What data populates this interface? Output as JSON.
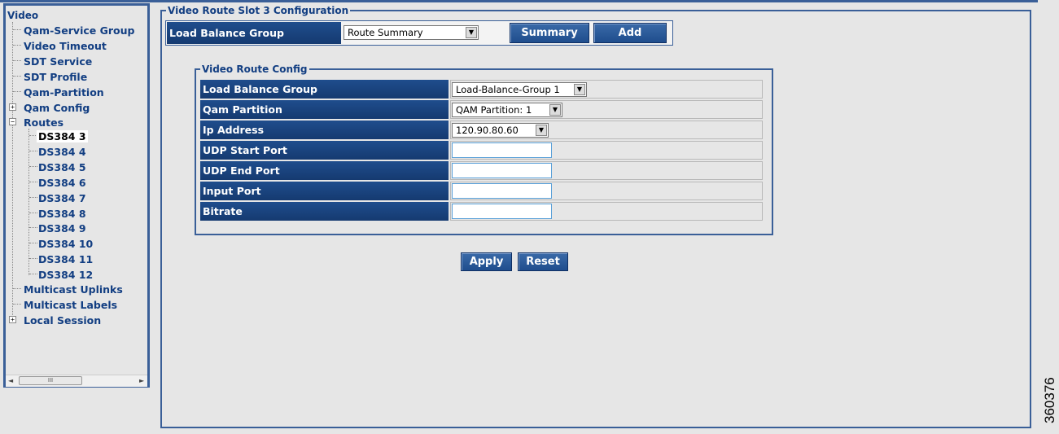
{
  "tree": {
    "root": "Video",
    "items": [
      {
        "label": "Qam-Service Group"
      },
      {
        "label": "Video Timeout"
      },
      {
        "label": "SDT Service"
      },
      {
        "label": "SDT Profile"
      },
      {
        "label": "Qam-Partition"
      },
      {
        "label": "Qam Config",
        "expander": "+"
      },
      {
        "label": "Routes",
        "expander": "−"
      },
      {
        "label": "DS384 3",
        "selected": true
      },
      {
        "label": "DS384 4"
      },
      {
        "label": "DS384 5"
      },
      {
        "label": "DS384 6"
      },
      {
        "label": "DS384 7"
      },
      {
        "label": "DS384 8"
      },
      {
        "label": "DS384 9"
      },
      {
        "label": "DS384 10"
      },
      {
        "label": "DS384 11"
      },
      {
        "label": "DS384 12"
      },
      {
        "label": "Multicast Uplinks"
      },
      {
        "label": "Multicast Labels"
      },
      {
        "label": "Local Session",
        "expander": "+"
      }
    ],
    "scroll_left": "◄",
    "scroll_right": "►",
    "scroll_thumb": "III"
  },
  "main": {
    "legend": "Video Route Slot 3 Configuration",
    "lbg_label": "Load Balance Group",
    "lbg_select": "Route Summary",
    "summary_button": "Summary",
    "add_button": "Add"
  },
  "vrc": {
    "legend": "Video Route Config",
    "rows": [
      {
        "label": "Load Balance Group",
        "type": "select",
        "value": "Load-Balance-Group 1"
      },
      {
        "label": "Qam Partition",
        "type": "select",
        "value": "QAM Partition: 1"
      },
      {
        "label": "Ip Address",
        "type": "select",
        "value": "120.90.80.60"
      },
      {
        "label": "UDP Start Port",
        "type": "input",
        "value": ""
      },
      {
        "label": "UDP End Port",
        "type": "input",
        "value": ""
      },
      {
        "label": "Input Port",
        "type": "input",
        "value": ""
      },
      {
        "label": "Bitrate",
        "type": "input",
        "value": ""
      }
    ]
  },
  "buttons": {
    "apply": "Apply",
    "reset": "Reset"
  },
  "side_number": "360376",
  "icons": {
    "dropdown": "▼",
    "expand": "+",
    "collapse": "−"
  },
  "colors": {
    "accent": "#3a5f98",
    "label_bg": "#1f4d8d",
    "tree_text": "#123e82"
  }
}
